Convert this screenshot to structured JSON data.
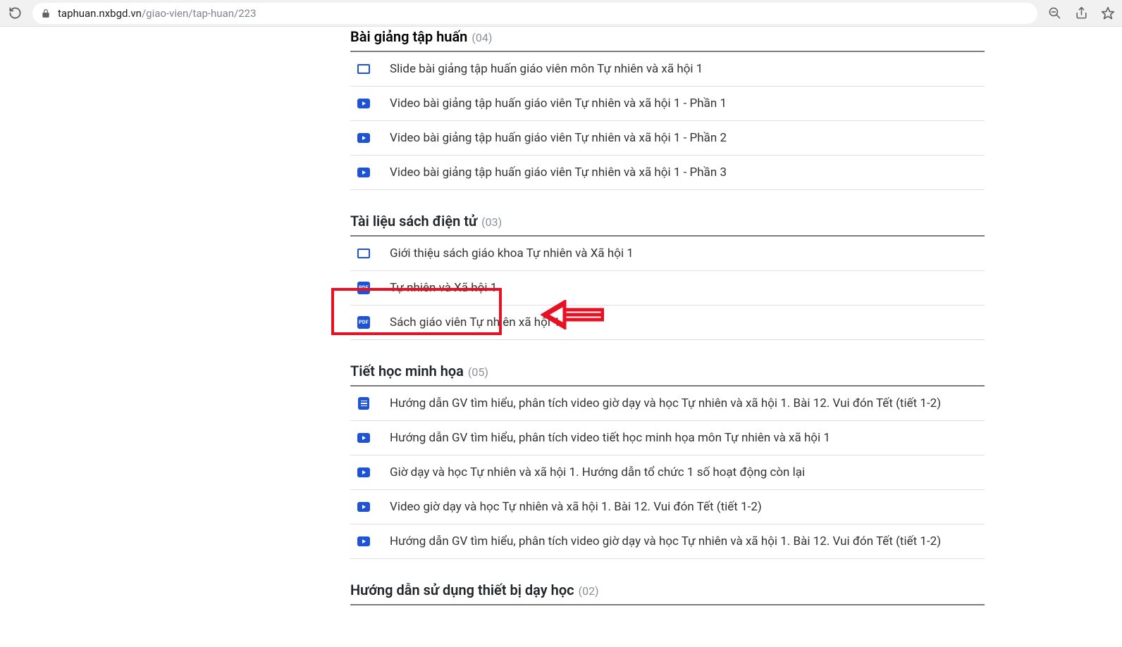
{
  "browser": {
    "url_host": "taphuan.nxbgd.vn",
    "url_path": "/giao-vien/tap-huan/223"
  },
  "sections": [
    {
      "title": "Bài giảng tập huấn",
      "count": "(04)",
      "partial": true,
      "items": [
        {
          "icon": "presentation",
          "label": "Slide bài giảng tập huấn giáo viên môn Tự nhiên và xã hội 1"
        },
        {
          "icon": "video",
          "label": "Video bài giảng tập huấn giáo viên Tự nhiên và xã hội 1 - Phần 1"
        },
        {
          "icon": "video",
          "label": "Video bài giảng tập huấn giáo viên Tự nhiên và xã hội 1 - Phần 2"
        },
        {
          "icon": "video",
          "label": "Video bài giảng tập huấn giáo viên Tự nhiên và xã hội 1 - Phần 3"
        }
      ]
    },
    {
      "title": "Tài liệu sách điện tử",
      "count": "(03)",
      "items": [
        {
          "icon": "presentation",
          "label": "Giới thiệu sách giáo khoa Tự nhiên và Xã hội 1"
        },
        {
          "icon": "pdf",
          "label": "Tự nhiên và Xã hội 1",
          "highlighted": true
        },
        {
          "icon": "pdf",
          "label": "Sách giáo viên Tự nhiên xã hội 1"
        }
      ]
    },
    {
      "title": "Tiết học minh họa",
      "count": "(05)",
      "items": [
        {
          "icon": "doc",
          "label": "Hướng dẫn GV tìm hiểu, phân tích video giờ dạy và học Tự nhiên và xã hội 1. Bài 12. Vui đón Tết (tiết 1-2)"
        },
        {
          "icon": "video",
          "label": "Hướng dẫn GV tìm hiểu, phân tích video tiết học minh họa môn Tự nhiên và xã hội 1"
        },
        {
          "icon": "video",
          "label": "Giờ dạy và học Tự nhiên và xã hội 1. Hướng dẫn tổ chức 1 số hoạt động còn lại"
        },
        {
          "icon": "video",
          "label": "Video giờ dạy và học Tự nhiên và xã hội 1. Bài 12. Vui đón Tết (tiết 1-2)"
        },
        {
          "icon": "video",
          "label": "Hướng dẫn GV tìm hiểu, phân tích video giờ dạy và học Tự nhiên và xã hội 1. Bài 12. Vui đón Tết (tiết 1-2)"
        }
      ]
    },
    {
      "title": "Hướng dẫn sử dụng thiết bị dạy học",
      "count": "(02)",
      "items": []
    }
  ],
  "pdf_badge": "PDF"
}
